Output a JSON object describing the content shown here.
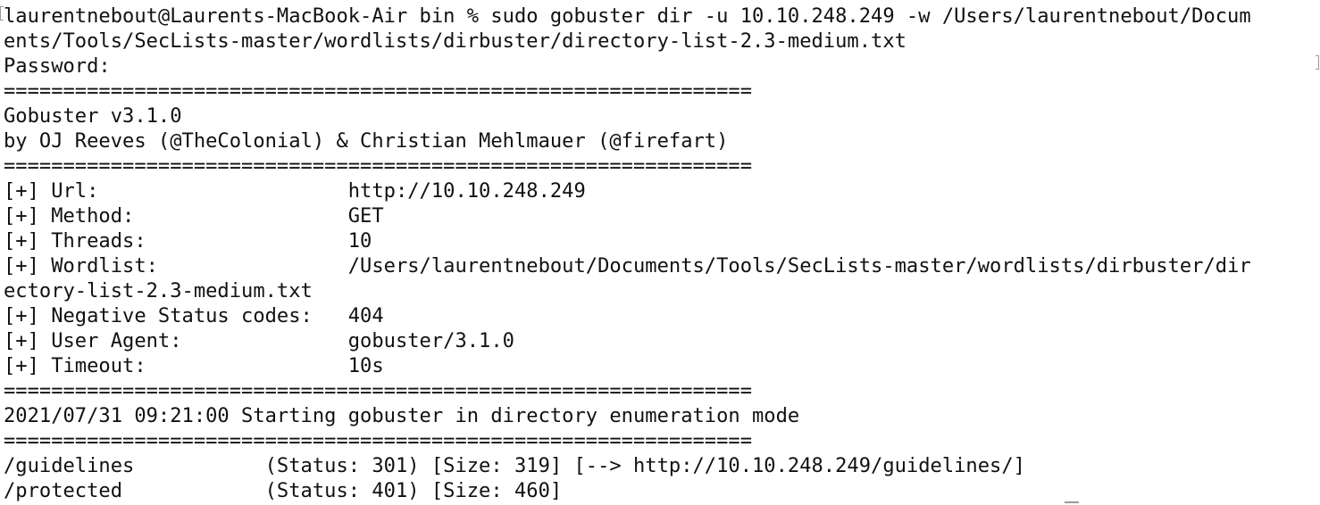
{
  "terminal": {
    "lines": [
      "laurentnebout@Laurents-MacBook-Air bin % sudo gobuster dir -u 10.10.248.249 -w /Users/laurentnebout/Docum",
      "ents/Tools/SecLists-master/wordlists/dirbuster/directory-list-2.3-medium.txt",
      "Password:",
      "===============================================================",
      "Gobuster v3.1.0",
      "by OJ Reeves (@TheColonial) & Christian Mehlmauer (@firefart)",
      "===============================================================",
      "[+] Url:                     http://10.10.248.249",
      "[+] Method:                  GET",
      "[+] Threads:                 10",
      "[+] Wordlist:                /Users/laurentnebout/Documents/Tools/SecLists-master/wordlists/dirbuster/dir",
      "ectory-list-2.3-medium.txt",
      "[+] Negative Status codes:   404",
      "[+] User Agent:              gobuster/3.1.0",
      "[+] Timeout:                 10s",
      "===============================================================",
      "2021/07/31 09:21:00 Starting gobuster in directory enumeration mode",
      "===============================================================",
      "/guidelines           (Status: 301) [Size: 319] [--> http://10.10.248.249/guidelines/]",
      "/protected            (Status: 401) [Size: 460]"
    ]
  }
}
